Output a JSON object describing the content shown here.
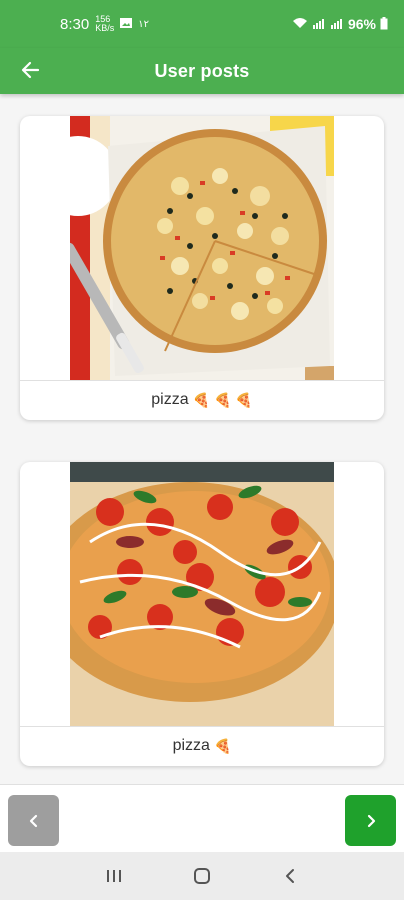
{
  "status_bar": {
    "time": "8:30",
    "mini_top": "156",
    "mini_bottom": "KB/s",
    "extra": "١٢",
    "battery": "96%"
  },
  "app_bar": {
    "title": "User posts",
    "back_icon": "arrow-back-icon"
  },
  "posts": [
    {
      "caption": "pizza",
      "emojis": "🍕 🍕 🍕",
      "image_desc": "veggie pizza on parchment"
    },
    {
      "caption": "pizza",
      "emojis": "🍕",
      "image_desc": "pizza with tomatoes and basil"
    }
  ],
  "navigation": {
    "prev_icon": "chevron-left-icon",
    "next_icon": "chevron-right-icon",
    "prev_color": "#9e9e9e",
    "next_color": "#1fa12c"
  },
  "colors": {
    "primary": "#4caf50",
    "background": "#f5f5f5"
  }
}
